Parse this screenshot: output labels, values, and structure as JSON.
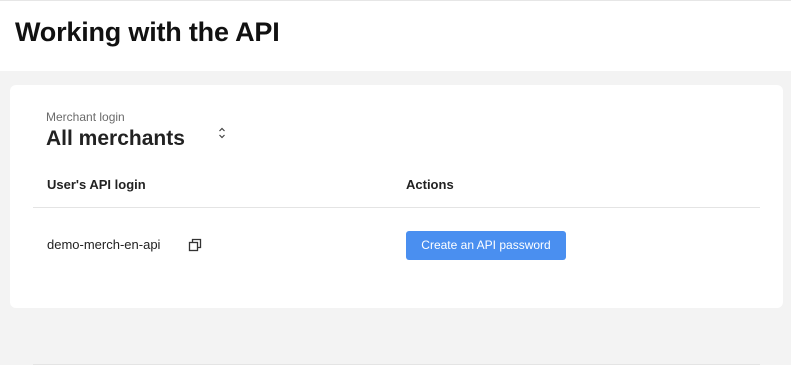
{
  "page": {
    "title": "Working with the API"
  },
  "merchant_filter": {
    "label": "Merchant login",
    "selected": "All merchants"
  },
  "table": {
    "columns": [
      "User's API login",
      "Actions"
    ],
    "rows": [
      {
        "api_login": "demo-merch-en-api",
        "action_label": "Create an API password"
      }
    ]
  },
  "colors": {
    "accent": "#4a8ff0",
    "background": "#f3f3f3",
    "card": "#ffffff"
  },
  "icons": {
    "sort": "sort-updown-icon",
    "copy": "copy-icon"
  }
}
